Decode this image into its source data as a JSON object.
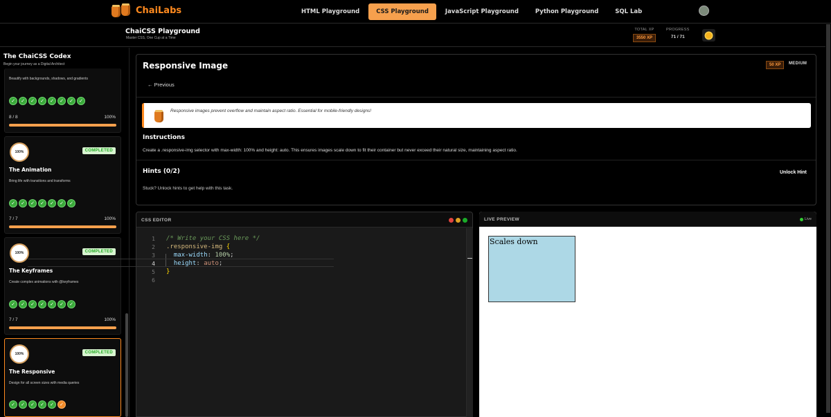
{
  "brand": {
    "name": "ChaiLabs"
  },
  "nav": {
    "links": [
      "HTML Playground",
      "CSS Playground",
      "JavaScript Playground",
      "Python Playground",
      "SQL Lab"
    ],
    "active": "CSS Playground"
  },
  "header": {
    "title": "ChaiCSS Playground",
    "tagline": "Master CSS, One Cup at a Time",
    "total_xp_label": "TOTAL XP",
    "total_xp": "3550 XP",
    "progress_label": "PROGRESS",
    "progress": "71 / 71"
  },
  "sidebar": {
    "title": "The ChaiCSS Codex",
    "subtitle": "Begin your journey as a Digital Architect",
    "top_card": {
      "desc": "Beautify with backgrounds, shadows, and gradients",
      "count": "8 / 8",
      "pct": "100%",
      "progress": 1.0
    },
    "cards": [
      {
        "badge": "100%",
        "status": "COMPLETED",
        "title": "The Animation",
        "desc": "Bring life with transitions and transforms",
        "count": "7 / 7",
        "pct": "100%",
        "progress": 1.0
      },
      {
        "badge": "100%",
        "status": "COMPLETED",
        "title": "The Keyframes",
        "desc": "Create complex animations with @keyframes",
        "count": "7 / 7",
        "pct": "100%",
        "progress": 1.0
      },
      {
        "badge": "100%",
        "status": "COMPLETED",
        "title": "The Responsive",
        "desc": "Design for all screen sizes with media queries"
      }
    ]
  },
  "challenge": {
    "title": "Responsive Image",
    "xp": "50 XP",
    "difficulty": "MEDIUM",
    "previous_label": "← Previous",
    "tip": "Responsive images prevent overflow and maintain aspect ratio. Essential for mobile-friendly designs!",
    "instructions_heading": "Instructions",
    "instructions": "Create a .responsive-img selector with max-width: 100% and height: auto. This ensures images scale down to fit their container but never exceed their natural size, maintaining aspect ratio.",
    "hints_heading": "Hints (0/2)",
    "unlock_label": "Unlock Hint",
    "stuck_text": "Stuck? Unlock hints to get help with this task."
  },
  "editor": {
    "label": "CSS EDITOR",
    "line_numbers": [
      "1",
      "2",
      "3",
      "4",
      "5",
      "6"
    ],
    "code": {
      "comment": "/* Write your CSS here */",
      "selector": ".responsive-img",
      "open_brace": "{",
      "prop1": "max-width",
      "val1": "100",
      "unit1": "%",
      "prop2": "height",
      "val2": "auto",
      "colon": ":",
      "semi": ";",
      "close_brace": "}"
    }
  },
  "preview": {
    "label": "LIVE PREVIEW",
    "live_label": "Live",
    "box_text": "Scales down"
  },
  "colors": {
    "accent": "#f6a04d",
    "brand": "#ff8a1f",
    "success": "#3aaa3a"
  }
}
